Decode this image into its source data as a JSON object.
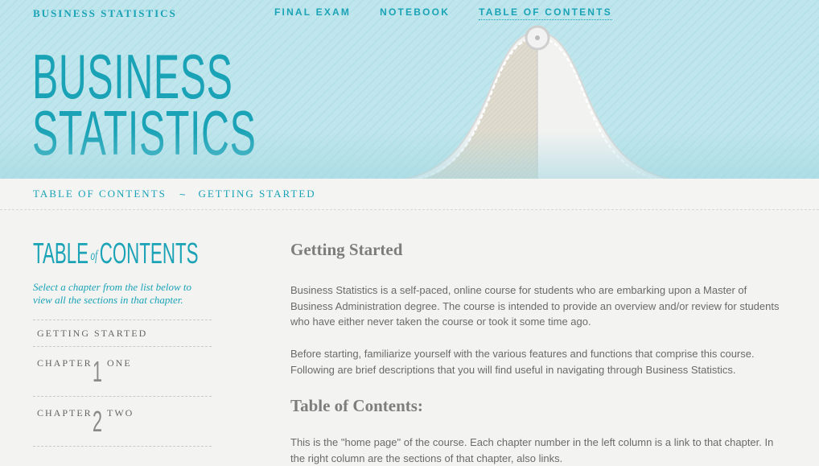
{
  "header": {
    "site_name": "BUSINESS STATISTICS",
    "nav": [
      "FINAL EXAM",
      "NOTEBOOK",
      "TABLE OF CONTENTS"
    ],
    "active_nav": "TABLE OF CONTENTS",
    "title_line1": "BUSINESS",
    "title_line2": "STATISTICS"
  },
  "breadcrumb": {
    "items": [
      "TABLE OF CONTENTS",
      "GETTING STARTED"
    ],
    "separator": "~"
  },
  "sidebar": {
    "title_part1": "TABLE",
    "title_of": "of",
    "title_part2": "CONTENTS",
    "intro": "Select a chapter from the list below to view all the sections in that chapter.",
    "getting_started": "GETTING STARTED",
    "chapters": [
      {
        "word": "CHAPTER",
        "number": "1",
        "name": "ONE"
      },
      {
        "word": "CHAPTER",
        "number": "2",
        "name": "TWO"
      }
    ]
  },
  "main": {
    "heading": "Getting Started",
    "para1": "Business Statistics is a self-paced, online course for students who are embarking upon a Master of Business Administration degree. The course is intended to provide an overview and/or review for students who have either never taken the course or took it some time ago.",
    "para2": "Before starting, familiarize yourself with the various features and functions that comprise this course. Following are brief descriptions that you will find useful in navigating through Business Statistics.",
    "heading2": "Table of Contents:",
    "para3": "This is the \"home page\" of the course. Each chapter number in the left column is a link to that chapter. In the right column are the sections of that chapter, also links."
  },
  "colors": {
    "accent": "#1aa3b6",
    "header_bg": "#bfe6ec",
    "text": "#6a6a6a"
  }
}
